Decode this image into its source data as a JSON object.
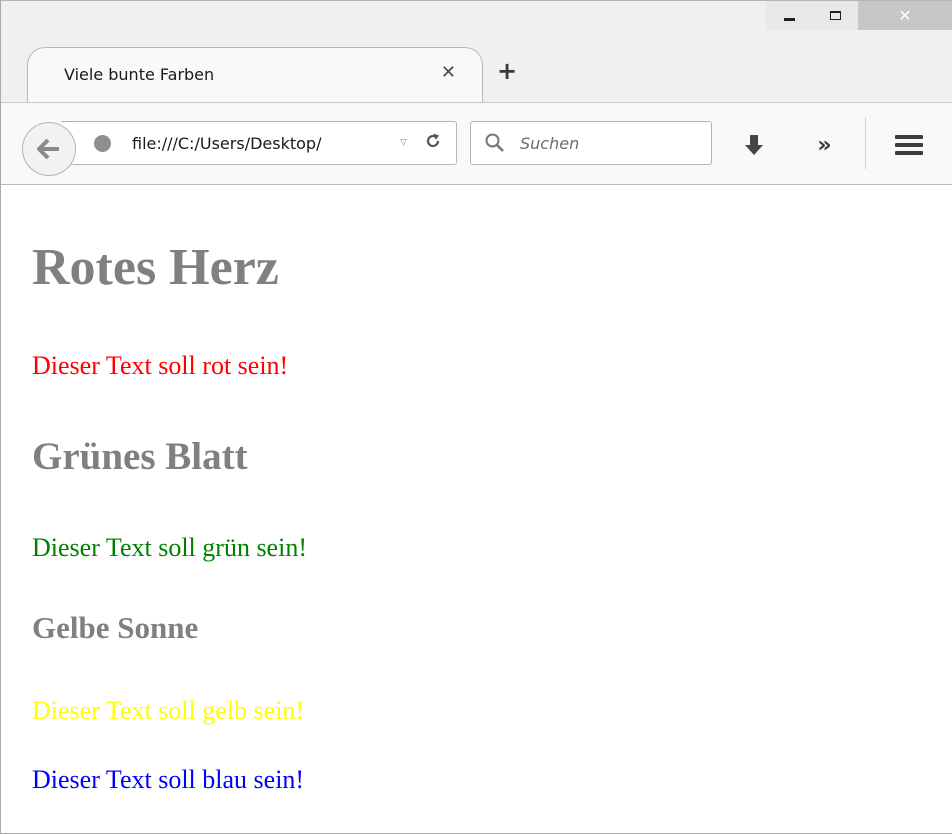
{
  "window": {
    "minimize_icon": "minimize-icon",
    "maximize_icon": "maximize-icon",
    "close_glyph": "✕"
  },
  "tab": {
    "title": "Viele bunte Farben",
    "close_glyph": "✕",
    "new_tab_glyph": "+"
  },
  "navbar": {
    "back_glyph": "←",
    "url": "file:///C:/Users/Desktop/",
    "url_dropdown_glyph": "▿",
    "reload_glyph": "C",
    "search_placeholder": "Suchen",
    "overflow_glyph": "»"
  },
  "page": {
    "heading1": "Rotes Herz",
    "text1": "Dieser Text soll rot sein!",
    "heading2": "Grünes Blatt",
    "text2": "Dieser Text soll grün sein!",
    "heading3": "Gelbe Sonne",
    "text3": "Dieser Text soll gelb sein!",
    "text4": "Dieser Text soll blau sein!"
  },
  "colors": {
    "heading": "#808080",
    "red": "#ff0000",
    "green": "#008000",
    "yellow": "#ffff00",
    "blue": "#0000ff"
  }
}
